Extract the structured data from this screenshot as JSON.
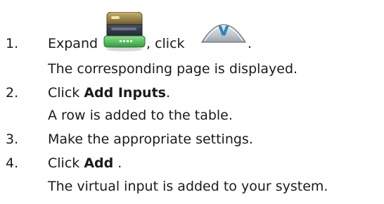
{
  "steps": [
    {
      "number": "1.",
      "instruction": {
        "pre": "Expand",
        "mid": ", click",
        "post": ".",
        "icons": [
          "device-tree-expand-icon",
          "virtual-input-icon"
        ]
      },
      "result": "The corresponding page is displayed."
    },
    {
      "number": "2.",
      "instruction": {
        "pre": "Click ",
        "bold": "Add Inputs",
        "post": "."
      },
      "result": "A row is added to the table."
    },
    {
      "number": "3.",
      "instruction": {
        "text": "Make the appropriate settings."
      }
    },
    {
      "number": "4.",
      "instruction": {
        "pre": "Click ",
        "bold": "Add",
        "post": " ."
      },
      "result": "The virtual input is added to your system."
    }
  ]
}
